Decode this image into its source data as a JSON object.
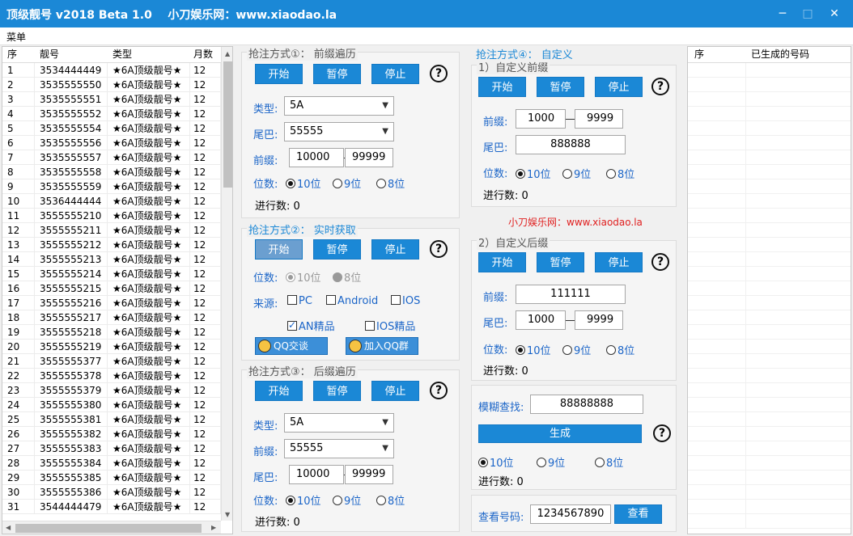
{
  "window": {
    "title": "顶级靓号 v2018 Beta 1.0    小刀娱乐网：www.xiaodao.la",
    "minimize": "─",
    "maximize": "□",
    "close": "✕"
  },
  "menu": {
    "label": "菜单"
  },
  "list": {
    "headers": [
      "序",
      "靓号",
      "类型",
      "月数"
    ],
    "rows": [
      [
        "1",
        "3534444449",
        "★6A顶级靓号★",
        "12"
      ],
      [
        "2",
        "3535555550",
        "★6A顶级靓号★",
        "12"
      ],
      [
        "3",
        "3535555551",
        "★6A顶级靓号★",
        "12"
      ],
      [
        "4",
        "3535555552",
        "★6A顶级靓号★",
        "12"
      ],
      [
        "5",
        "3535555554",
        "★6A顶级靓号★",
        "12"
      ],
      [
        "6",
        "3535555556",
        "★6A顶级靓号★",
        "12"
      ],
      [
        "7",
        "3535555557",
        "★6A顶级靓号★",
        "12"
      ],
      [
        "8",
        "3535555558",
        "★6A顶级靓号★",
        "12"
      ],
      [
        "9",
        "3535555559",
        "★6A顶级靓号★",
        "12"
      ],
      [
        "10",
        "3536444444",
        "★6A顶级靓号★",
        "12"
      ],
      [
        "11",
        "3555555210",
        "★6A顶级靓号★",
        "12"
      ],
      [
        "12",
        "3555555211",
        "★6A顶级靓号★",
        "12"
      ],
      [
        "13",
        "3555555212",
        "★6A顶级靓号★",
        "12"
      ],
      [
        "14",
        "3555555213",
        "★6A顶级靓号★",
        "12"
      ],
      [
        "15",
        "3555555214",
        "★6A顶级靓号★",
        "12"
      ],
      [
        "16",
        "3555555215",
        "★6A顶级靓号★",
        "12"
      ],
      [
        "17",
        "3555555216",
        "★6A顶级靓号★",
        "12"
      ],
      [
        "18",
        "3555555217",
        "★6A顶级靓号★",
        "12"
      ],
      [
        "19",
        "3555555218",
        "★6A顶级靓号★",
        "12"
      ],
      [
        "20",
        "3555555219",
        "★6A顶级靓号★",
        "12"
      ],
      [
        "21",
        "3555555377",
        "★6A顶级靓号★",
        "12"
      ],
      [
        "22",
        "3555555378",
        "★6A顶级靓号★",
        "12"
      ],
      [
        "23",
        "3555555379",
        "★6A顶级靓号★",
        "12"
      ],
      [
        "24",
        "3555555380",
        "★6A顶级靓号★",
        "12"
      ],
      [
        "25",
        "3555555381",
        "★6A顶级靓号★",
        "12"
      ],
      [
        "26",
        "3555555382",
        "★6A顶级靓号★",
        "12"
      ],
      [
        "27",
        "3555555383",
        "★6A顶级靓号★",
        "12"
      ],
      [
        "28",
        "3555555384",
        "★6A顶级靓号★",
        "12"
      ],
      [
        "29",
        "3555555385",
        "★6A顶级靓号★",
        "12"
      ],
      [
        "30",
        "3555555386",
        "★6A顶级靓号★",
        "12"
      ],
      [
        "31",
        "3544444479",
        "★6A顶级靓号★",
        "12"
      ]
    ]
  },
  "m1": {
    "title": "抢注方式①： 前缀遍历",
    "start": "开始",
    "pause": "暂停",
    "stop": "停止",
    "help": "?",
    "type_label": "类型:",
    "type_value": "5A",
    "tail_label": "尾巴:",
    "tail_value": "55555",
    "prefix_label": "前缀:",
    "prefix_from": "10000",
    "prefix_to": "99999",
    "digits_label": "位数:",
    "d10": "10位",
    "d9": "9位",
    "d8": "8位",
    "progress": "进行数:  0"
  },
  "m2": {
    "title": "抢注方式②： 实时获取",
    "start": "开始",
    "pause": "暂停",
    "stop": "停止",
    "help": "?",
    "digits_label": "位数:",
    "d10": "10位",
    "d8": "8位",
    "source_label": "来源:",
    "pc": "PC",
    "android": "Android",
    "ios": "IOS",
    "an": "AN精品",
    "iosjp": "IOS精品",
    "qq_chat": "QQ交谈",
    "join_qq": "加入QQ群"
  },
  "m3": {
    "title": "抢注方式③： 后缀遍历",
    "start": "开始",
    "pause": "暂停",
    "stop": "停止",
    "help": "?",
    "type_label": "类型:",
    "type_value": "5A",
    "prefix_label": "前缀:",
    "prefix_value": "55555",
    "tail_label": "尾巴:",
    "tail_from": "10000",
    "tail_to": "99999",
    "digits_label": "位数:",
    "d10": "10位",
    "d9": "9位",
    "d8": "8位",
    "progress": "进行数:  0"
  },
  "m4": {
    "title": "抢注方式④： 自定义",
    "g1": {
      "title": "1）自定义前缀",
      "start": "开始",
      "pause": "暂停",
      "stop": "停止",
      "help": "?",
      "prefix_label": "前缀:",
      "prefix_from": "1000",
      "prefix_to": "9999",
      "tail_label": "尾巴:",
      "tail_value": "888888",
      "digits_label": "位数:",
      "d10": "10位",
      "d9": "9位",
      "d8": "8位",
      "progress": "进行数:  0"
    },
    "site": "小刀娱乐网：www.xiaodao.la",
    "g2": {
      "title": "2）自定义后缀",
      "start": "开始",
      "pause": "暂停",
      "stop": "停止",
      "help": "?",
      "prefix_label": "前缀:",
      "prefix_value": "111111",
      "tail_label": "尾巴:",
      "tail_from": "1000",
      "tail_to": "9999",
      "digits_label": "位数:",
      "d10": "10位",
      "d9": "9位",
      "d8": "8位",
      "progress": "进行数:  0"
    },
    "fuzzy": {
      "label": "模糊查找:",
      "value": "88888888",
      "generate": "生成",
      "help": "?",
      "d10": "10位",
      "d9": "9位",
      "d8": "8位",
      "progress": "进行数:  0"
    },
    "lookup": {
      "label": "查看号码:",
      "value": "1234567890",
      "button": "查看"
    }
  },
  "generated": {
    "headers": [
      "序",
      "已生成的号码"
    ]
  },
  "colors": {
    "accent": "#1b88d6"
  }
}
